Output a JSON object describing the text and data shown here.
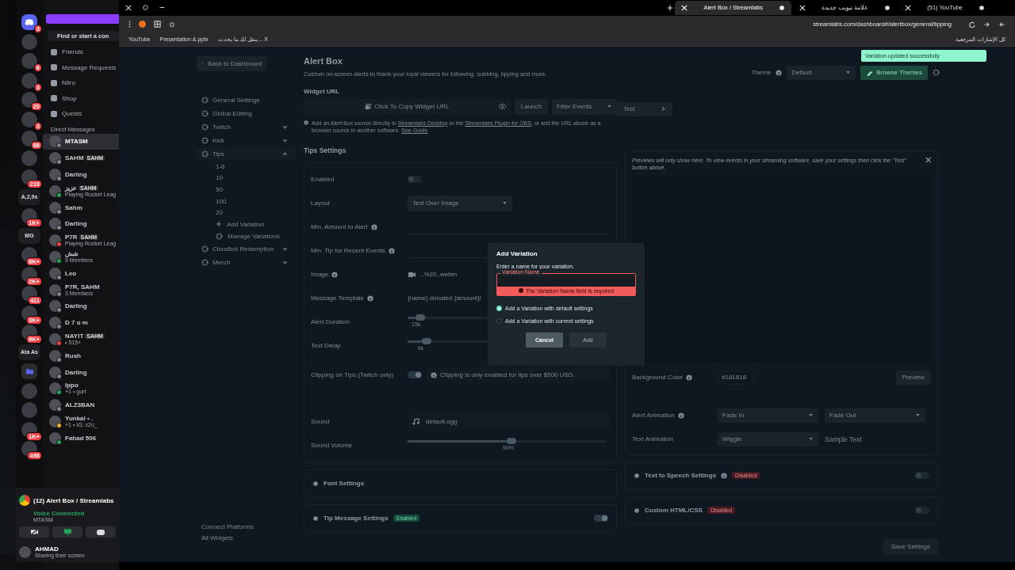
{
  "discord": {
    "servers": [
      {
        "kind": "home",
        "badge": "3"
      },
      {
        "kind": "icon"
      },
      {
        "kind": "icon",
        "badge": "6"
      },
      {
        "kind": "icon",
        "badge": "3"
      },
      {
        "kind": "icon",
        "badge": "20"
      },
      {
        "kind": "icon",
        "badge": "3"
      },
      {
        "kind": "icon",
        "badge": "88"
      },
      {
        "kind": "icon"
      },
      {
        "kind": "icon",
        "badge": "219"
      },
      {
        "kind": "label",
        "label": "A,2,9s"
      },
      {
        "kind": "icon",
        "badge": "1K+"
      },
      {
        "kind": "label",
        "label": "MG"
      },
      {
        "kind": "icon",
        "badge": "8K+"
      },
      {
        "kind": "icon",
        "badge": "2K+"
      },
      {
        "kind": "icon",
        "badge": "411"
      },
      {
        "kind": "icon",
        "badge": "3K+"
      },
      {
        "kind": "icon",
        "badge": "9K+"
      },
      {
        "kind": "label",
        "label": "Ata As"
      },
      {
        "kind": "folder"
      },
      {
        "kind": "icon"
      },
      {
        "kind": "icon"
      },
      {
        "kind": "icon",
        "badge": "1K+"
      },
      {
        "kind": "icon",
        "badge": "498"
      }
    ],
    "search": {
      "placeholder": "Find or start a con"
    },
    "nav": [
      "Friends",
      "Message Requests",
      "Nitro",
      "Shop",
      "Quests"
    ],
    "dm_header": "Direct Messages",
    "dms": [
      {
        "name": "MTASM",
        "selected": true,
        "color": "#80848e"
      },
      {
        "name": "SAHM",
        "tag": "SAHM",
        "selected": false,
        "color": "#80848e"
      },
      {
        "name": "Darling",
        "selected": false,
        "color": "#80848e"
      },
      {
        "name": "عزيز",
        "tag": "SAHM",
        "subtitle": "Playing Rocket Leag",
        "selected": false,
        "color": "#23a55a"
      },
      {
        "name": "Sahm",
        "selected": false,
        "color": "#80848e"
      },
      {
        "name": "Darling",
        "selected": false,
        "color": "#80848e"
      },
      {
        "name": "P7R",
        "tag": "SAHM",
        "subtitle": "Playing Rocket Leag",
        "selected": false,
        "color": "#f23f43"
      },
      {
        "name": "شش",
        "subtitle": "9 Members",
        "selected": false,
        "color": "#23a55a"
      },
      {
        "name": "Leo",
        "selected": false,
        "color": "#80848e"
      },
      {
        "name": "P7R, SAHM",
        "subtitle": "3 Members",
        "selected": false,
        "color": "#80848e"
      },
      {
        "name": "Darling",
        "selected": false,
        "color": "#80848e"
      },
      {
        "name": "D 7 o m",
        "selected": false,
        "color": "#80848e"
      },
      {
        "name": "NAYIT",
        "tag": "SAHM",
        "subtitle": "• 515+",
        "selected": false,
        "color": "#f23f43"
      },
      {
        "name": "Rush",
        "selected": false,
        "color": "#80848e"
      },
      {
        "name": "Darling",
        "selected": false,
        "color": "#80848e"
      },
      {
        "name": "Ippo",
        "subtitle": "+1 • gurt",
        "selected": false,
        "color": "#23a55a"
      },
      {
        "name": "ALZ3BAN",
        "selected": false,
        "color": "#80848e"
      },
      {
        "name": "Yunkai • .",
        "subtitle": "+1 • IG: z2o_",
        "selected": false,
        "color": "#f0b232"
      },
      {
        "name": "Fahad 506",
        "selected": false,
        "color": "#23a55a"
      }
    ],
    "activity": "(12) Alert Box / Streamlabs",
    "voice": {
      "status": "Voice Connected",
      "channel": "MTASM"
    },
    "user": {
      "name": "AHMAD",
      "status": "Sharing their screen"
    }
  },
  "browser": {
    "tabs": [
      {
        "title": "Alert Box / Streamlabs",
        "selected": true
      },
      {
        "title": "علامة تبويب جديدة",
        "selected": false
      },
      {
        "title": "(51) YouTube",
        "selected": false
      }
    ],
    "address": "streamlabs.com/dashboard#/alertbox/general/tipping",
    "bookmarks": [
      "YouTube",
      "Presentation &.pptx",
      "ينقل لك ما يحدث... X"
    ],
    "all_bookmarks": "كل الإشارات المرجعية"
  },
  "sidebar": {
    "back": "Back to Dashboard",
    "items": [
      {
        "label": "General Settings"
      },
      {
        "label": "Global Editing"
      },
      {
        "label": "Twitch",
        "expanded": false
      },
      {
        "label": "Kick",
        "expanded": false
      },
      {
        "label": "Tips",
        "expanded": true,
        "children": [
          {
            "label": "1-6"
          },
          {
            "label": "10"
          },
          {
            "label": "50"
          },
          {
            "label": "100"
          },
          {
            "label": "20"
          }
        ],
        "actions": [
          "Add Variation",
          "Manage Variations"
        ]
      },
      {
        "label": "Cloudbot Redemption",
        "expanded": false
      },
      {
        "label": "Merch",
        "expanded": false
      }
    ],
    "footer": [
      "Connect Platforms",
      "All Widgets"
    ]
  },
  "main": {
    "title": "Alert Box",
    "description": "Custom on-screen alerts to thank your loyal viewers for following, subbing, tipping and more.",
    "theme": {
      "label": "Theme",
      "value": "Default",
      "button": "Browse Themes"
    },
    "widget_url": {
      "label": "Widget URL",
      "copy": "Click To Copy Widget URL",
      "launch": "Launch",
      "filter": "Filter Events",
      "test": "Test"
    },
    "info": {
      "before": "Add an Alert Box source directly in ",
      "link1": "Streamlabs Desktop",
      "middle": " or the ",
      "link2": "Streamlabs Plugin for OBS",
      "after": ", or add the URL above as a browser source in another software. ",
      "link3": "See Guide"
    },
    "settings_title": "Tips Settings",
    "settings": [
      {
        "kind": "toggle",
        "label": "Enabled",
        "on": false
      },
      {
        "kind": "select",
        "label": "Layout",
        "value": "Text Over Image"
      },
      {
        "kind": "input",
        "label": "Min. Amount to Alert",
        "help": true
      },
      {
        "kind": "input",
        "label": "Min. Tip for Recent Events",
        "help": true
      },
      {
        "kind": "file",
        "label": "Image",
        "help": true,
        "value": "..%20..webm"
      },
      {
        "kind": "text",
        "label": "Message Template",
        "help": true,
        "value": "{name} donated {amount}!"
      },
      {
        "kind": "slider",
        "label": "Alert Duration",
        "level": 0.04,
        "reading": "15s"
      },
      {
        "kind": "slider",
        "label": "Text Delay",
        "level": 0.07,
        "reading": "4s"
      },
      {
        "kind": "toggle",
        "label": "Clipping on Tips (Twitch only)",
        "on": true,
        "note": "Clipping is only enabled for tips over $500 USD."
      },
      {
        "kind": "sound",
        "label": "Sound",
        "value": "default.ogg"
      },
      {
        "kind": "slider",
        "label": "Sound Volume",
        "level": 0.5,
        "reading": "50%"
      }
    ],
    "sections": [
      {
        "title": "Font Settings"
      },
      {
        "title": "Tip Message Settings",
        "badge": "Enabled",
        "on": true
      }
    ]
  },
  "preview": {
    "note": "Previews will only show here. To view events in your streaming software, save your settings then click the \"Test\" button above.",
    "background_color": {
      "label": "Background Color",
      "value": "#181818"
    },
    "preview_button": "Preview",
    "alert_animation": {
      "label": "Alert Animation",
      "in": "Fade In",
      "out": "Fade Out"
    },
    "text_animation": {
      "label": "Text Animation",
      "value": "Wiggle",
      "sample": "Sample Text"
    },
    "sections": [
      {
        "title": "Text to Speech Settings",
        "help": true,
        "badge": "Disabled",
        "on": false
      },
      {
        "title": "Custom HTML/CSS",
        "badge": "Disabled",
        "on": false
      }
    ],
    "save_button": "Save Settings"
  },
  "toast": "Variation updated successfully",
  "modal": {
    "title": "Add Variation",
    "prompt": "Enter a name for your variation.",
    "field_label": "Variation Name",
    "error": "The Variation Name field is required",
    "options": [
      {
        "label": "Add a Variation with default settings",
        "selected": true
      },
      {
        "label": "Add a Variation with current settings",
        "selected": false
      }
    ],
    "cancel": "Cancel",
    "add": "Add"
  }
}
